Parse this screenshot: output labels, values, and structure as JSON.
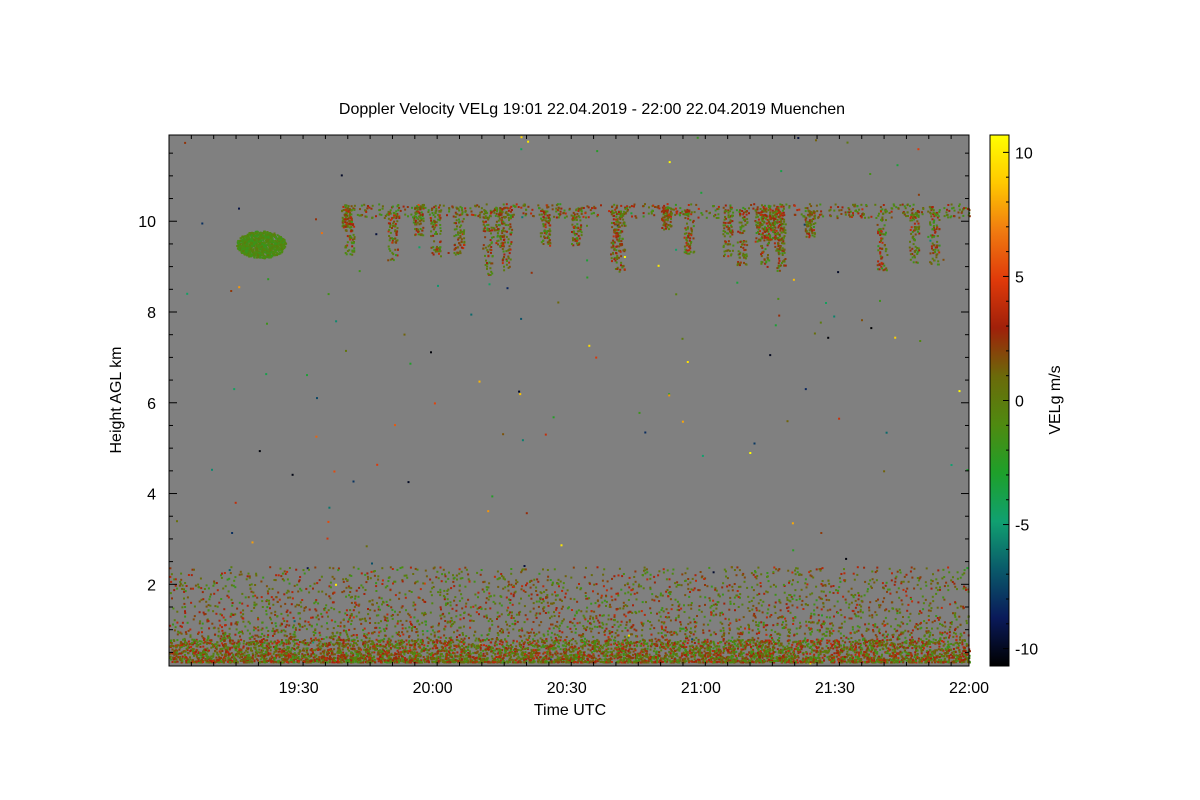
{
  "chart_data": {
    "type": "heatmap",
    "title": "Doppler Velocity VELg   19:01 22.04.2019 - 22:00 22.04.2019 Muenchen",
    "xlabel": "Time UTC",
    "ylabel": "Height AGL km",
    "colorbar_label": "VELg m/s",
    "x_range": [
      "19:01",
      "22:00"
    ],
    "x_ticks": [
      "19:30",
      "20:00",
      "20:30",
      "21:00",
      "21:30",
      "22:00"
    ],
    "y_range": [
      0.2,
      11.9
    ],
    "y_ticks": [
      2,
      4,
      6,
      8,
      10
    ],
    "colorbar_range": [
      -10.7,
      10.7
    ],
    "colorbar_ticks": [
      10,
      5,
      0,
      -5,
      -10
    ],
    "colorbar_colors": [
      "#000000",
      "#0a1a5a",
      "#0a5a6a",
      "#10a070",
      "#1ea02a",
      "#4f8a10",
      "#6b6a0a",
      "#a0200a",
      "#e03a0a",
      "#f07a10",
      "#ffc800",
      "#ffff00"
    ],
    "background_color": "#808080",
    "features": [
      {
        "label": "boundary layer",
        "time_start": "19:01",
        "time_end": "22:00",
        "height_min": 0.3,
        "height_max": 2.4,
        "velocity_range": [
          -2,
          4
        ]
      },
      {
        "label": "cirrus patch",
        "time_start": "19:16",
        "time_end": "19:27",
        "height_min": 9.2,
        "height_max": 9.8,
        "velocity_range": [
          -2,
          0
        ]
      },
      {
        "label": "cirrus fall streaks",
        "time_start": "19:40",
        "time_end": "22:00",
        "height_min": 8.9,
        "height_max": 10.4,
        "velocity_range": [
          -2,
          4
        ]
      }
    ]
  }
}
